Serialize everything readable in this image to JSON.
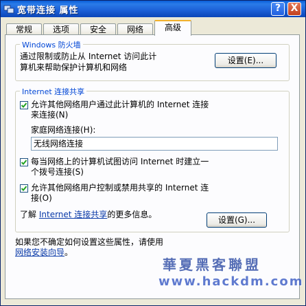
{
  "window": {
    "title": "宽带连接  属性",
    "help_button": "?",
    "close_button": "X"
  },
  "tabs": [
    {
      "label": "常规"
    },
    {
      "label": "选项"
    },
    {
      "label": "安全"
    },
    {
      "label": "网络"
    },
    {
      "label": "高级",
      "active": true
    }
  ],
  "firewall": {
    "group_title": "Windows 防火墙",
    "description_line1": "通过限制或防止从 Internet 访问此计",
    "description_line2": "算机来帮助保护计算机和网络",
    "settings_button": "设置(E)..."
  },
  "ics": {
    "group_title": "Internet 连接共享",
    "allow_connect": {
      "checked": true,
      "line1": "允许其他网络用户通过此计算机的 Internet 连接",
      "line2": "来连接(N)"
    },
    "home_network_label": "家庭网络连接(H):",
    "home_network_value": "无线网络连接",
    "dial_on_demand": {
      "checked": true,
      "line1": "每当网络上的计算机试图访问 Internet 时建立一",
      "line2": "个拨号连接(S)"
    },
    "allow_control": {
      "checked": true,
      "line1": "允许其他网络用户控制或禁用共享的 Internet 连",
      "line2": "接(O)"
    },
    "learn_prefix": "了解",
    "learn_link": "Internet 连接共享",
    "learn_suffix": "的更多信息。",
    "settings_button": "设置(G)..."
  },
  "footer": {
    "hint_text": "如果您不确定如何设置这些属性，请使用",
    "wizard_link": "网络安装向导",
    "hint_end": "。"
  },
  "watermark": {
    "line1": "華夏黑客聯盟",
    "line2": "www.hackdm.com"
  }
}
